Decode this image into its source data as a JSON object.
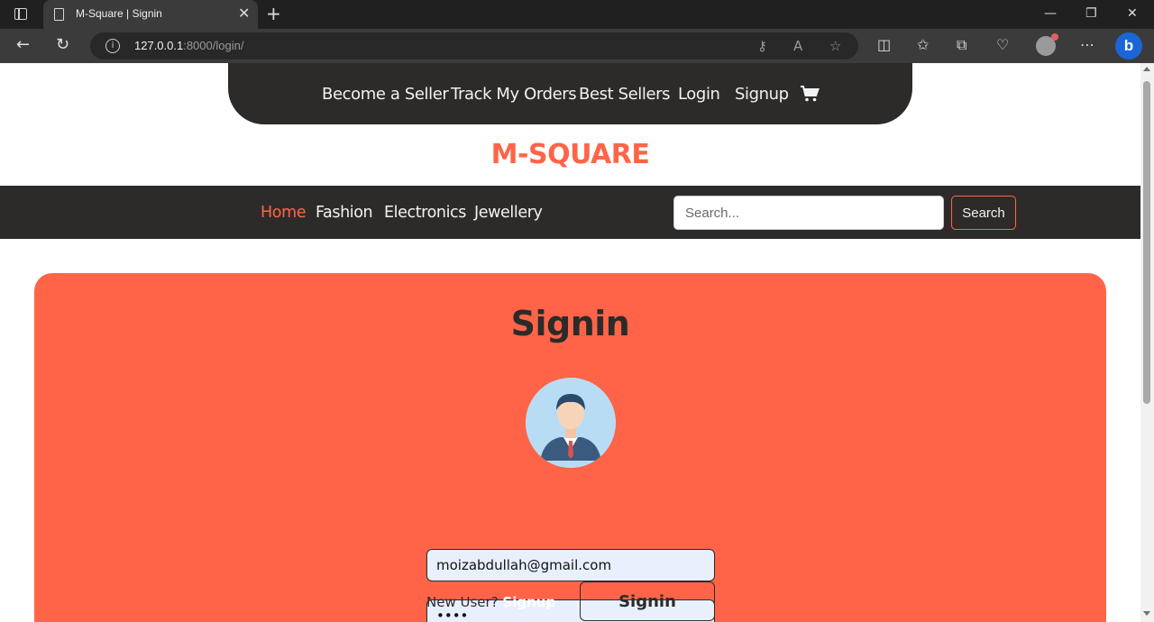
{
  "browser": {
    "tab_title": "M-Square | Signin",
    "url_host": "127.0.0.1",
    "url_rest": ":8000/login/",
    "icons": [
      "sidebar-icon",
      "document-icon",
      "close-icon",
      "new-tab-icon",
      "minimize-icon",
      "restore-icon",
      "window-close-icon",
      "back-icon",
      "refresh-icon",
      "info-icon",
      "key-icon",
      "read-aloud-icon",
      "favorite-icon",
      "split-screen-icon",
      "favorites-icon",
      "collections-icon",
      "performance-icon",
      "profile-icon",
      "more-icon",
      "bing-icon"
    ]
  },
  "topnav": {
    "links": [
      "Become a Seller",
      "Track My Orders",
      "Best Sellers",
      "Login",
      "Signup"
    ],
    "cart_icon": "cart-icon"
  },
  "brand": "M-SQUARE",
  "categories": [
    "Home",
    "Fashion",
    "Electronics",
    "Jewellery"
  ],
  "search": {
    "placeholder": "Search...",
    "button": "Search"
  },
  "signin": {
    "title": "Signin",
    "email_value": "moizabdullah@gmail.com",
    "password_value": "••••",
    "new_user_text": "New User?",
    "signup_link": "Signup",
    "submit_label": "Signin"
  },
  "colors": {
    "accent": "#ff6448",
    "dark": "#2d2b29"
  }
}
